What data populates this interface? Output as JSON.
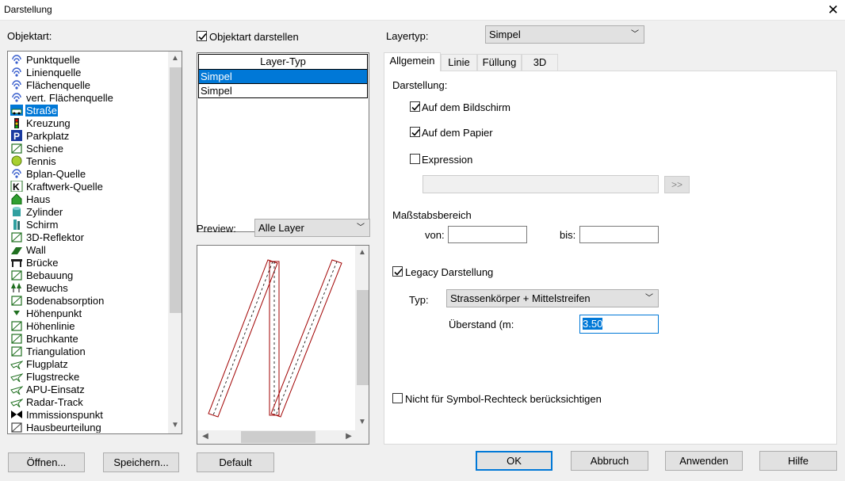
{
  "window": {
    "title": "Darstellung",
    "close_glyph": "✕"
  },
  "objektart": {
    "label": "Objektart:",
    "items": [
      {
        "label": "Punktquelle",
        "icon": "radio-icon",
        "color": "#3a5fcd"
      },
      {
        "label": "Linienquelle",
        "icon": "radio-icon",
        "color": "#3a5fcd"
      },
      {
        "label": "Flächenquelle",
        "icon": "radio-icon",
        "color": "#3a5fcd"
      },
      {
        "label": "vert. Flächenquelle",
        "icon": "vert-radio-icon",
        "color": "#3a5fcd"
      },
      {
        "label": "Straße",
        "icon": "car-icon",
        "color": "#207020",
        "selected": true
      },
      {
        "label": "Kreuzung",
        "icon": "traffic-light-icon",
        "color": "#c00000"
      },
      {
        "label": "Parkplatz",
        "icon": "parking-icon",
        "color": "#1a3aa0"
      },
      {
        "label": "Schiene",
        "icon": "train-icon",
        "color": "#207020"
      },
      {
        "label": "Tennis",
        "icon": "tennis-ball-icon",
        "color": "#a8d030"
      },
      {
        "label": "Bplan-Quelle",
        "icon": "bplan-icon",
        "color": "#3a5fcd"
      },
      {
        "label": "Kraftwerk-Quelle",
        "icon": "k-icon",
        "color": "#207020"
      },
      {
        "label": "Haus",
        "icon": "house-icon",
        "color": "#30a030"
      },
      {
        "label": "Zylinder",
        "icon": "cylinder-icon",
        "color": "#30a0a0"
      },
      {
        "label": "Schirm",
        "icon": "screen-icon",
        "color": "#30a0a0"
      },
      {
        "label": "3D-Reflektor",
        "icon": "reflector-icon",
        "color": "#207020"
      },
      {
        "label": "Wall",
        "icon": "wall-icon",
        "color": "#207020"
      },
      {
        "label": "Brücke",
        "icon": "bridge-icon",
        "color": "#202020"
      },
      {
        "label": "Bebauung",
        "icon": "buildings-icon",
        "color": "#207020"
      },
      {
        "label": "Bewuchs",
        "icon": "trees-icon",
        "color": "#207020"
      },
      {
        "label": "Bodenabsorption",
        "icon": "ground-icon",
        "color": "#207020"
      },
      {
        "label": "Höhenpunkt",
        "icon": "height-point-icon",
        "color": "#207020"
      },
      {
        "label": "Höhenlinie",
        "icon": "contour-icon",
        "color": "#207020"
      },
      {
        "label": "Bruchkante",
        "icon": "break-line-icon",
        "color": "#207020"
      },
      {
        "label": "Triangulation",
        "icon": "triangulation-icon",
        "color": "#207020"
      },
      {
        "label": "Flugplatz",
        "icon": "plane-icon",
        "color": "#207020"
      },
      {
        "label": "Flugstrecke",
        "icon": "plane-icon",
        "color": "#207020"
      },
      {
        "label": "APU-Einsatz",
        "icon": "plane-icon",
        "color": "#207020"
      },
      {
        "label": "Radar-Track",
        "icon": "plane-icon",
        "color": "#207020"
      },
      {
        "label": "Immissionspunkt",
        "icon": "bowtie-icon",
        "color": "#000000"
      },
      {
        "label": "Hausbeurteilung",
        "icon": "house-eval-icon",
        "color": "#404040"
      }
    ]
  },
  "objektart_darstellen": {
    "label": "Objektart darstellen",
    "checked": true
  },
  "layer_list": {
    "header": "Layer-Typ",
    "rows": [
      {
        "label": "Simpel",
        "selected": true
      },
      {
        "label": "Simpel",
        "selected": false
      }
    ]
  },
  "preview": {
    "label": "Preview:",
    "value": "Alle Layer"
  },
  "layertyp": {
    "label": "Layertyp:",
    "value": "Simpel"
  },
  "tabs": [
    {
      "label": "Allgemein",
      "active": true
    },
    {
      "label": "Linie"
    },
    {
      "label": "Füllung"
    },
    {
      "label": "3D"
    }
  ],
  "allgemein": {
    "darstellung_label": "Darstellung:",
    "bildschirm": {
      "label": "Auf dem Bildschirm",
      "checked": true
    },
    "papier": {
      "label": "Auf dem Papier",
      "checked": true
    },
    "expression": {
      "label": "Expression",
      "checked": false,
      "value": ""
    },
    "expr_button": ">>",
    "massstab_label": "Maßstabsbereich",
    "von_label": "von:",
    "von_value": "",
    "bis_label": "bis:",
    "bis_value": "",
    "legacy": {
      "label": "Legacy Darstellung",
      "checked": true
    },
    "typ_label": "Typ:",
    "typ_value": "Strassenkörper + Mittelstreifen",
    "ueberstand_label": "Überstand (m:",
    "ueberstand_value": "3.50",
    "symbol": {
      "label": "Nicht für Symbol-Rechteck berücksichtigen",
      "checked": false
    }
  },
  "buttons": {
    "oeffnen": "Öffnen...",
    "speichern": "Speichern...",
    "default": "Default",
    "ok": "OK",
    "abbruch": "Abbruch",
    "anwenden": "Anwenden",
    "hilfe": "Hilfe"
  },
  "colors": {
    "accent": "#0078d7",
    "road_outline": "#a00000"
  }
}
